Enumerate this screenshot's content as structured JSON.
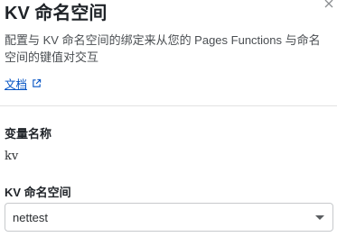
{
  "panel": {
    "title": "KV 命名空间",
    "description": "配置与 KV 命名空间的绑定来从您的 Pages Functions 与命名空间的键值对交互",
    "docs_link_label": "文档"
  },
  "fields": {
    "variable_name": {
      "label": "变量名称",
      "value": "kv"
    },
    "kv_namespace": {
      "label": "KV 命名空间",
      "selected": "nettest"
    }
  },
  "colors": {
    "link": "#0051c3",
    "divider": "#e2e2e2",
    "select_border": "#c7c9cc"
  },
  "icons": {
    "close": "close-icon",
    "external_link": "external-link-icon",
    "dropdown": "chevron-down-icon"
  }
}
